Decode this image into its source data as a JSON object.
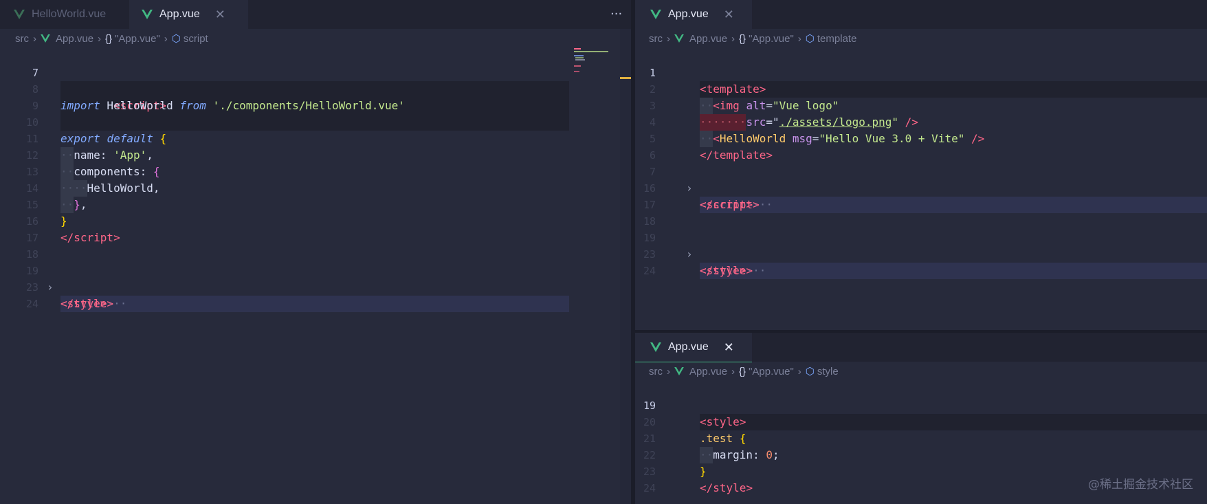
{
  "left": {
    "tabs": [
      {
        "label": "HelloWorld.vue",
        "active": false
      },
      {
        "label": "App.vue",
        "active": true,
        "close": "✕"
      }
    ],
    "more": "···",
    "breadcrumb": {
      "folder": "src",
      "file": "App.vue",
      "symbol_icon": "{}",
      "symbol": "\"App.vue\"",
      "section": "script"
    },
    "lines": [
      {
        "n": "7"
      },
      {
        "n": "8"
      },
      {
        "n": "9"
      },
      {
        "n": "10"
      },
      {
        "n": "11"
      },
      {
        "n": "12"
      },
      {
        "n": "13"
      },
      {
        "n": "14"
      },
      {
        "n": "15"
      },
      {
        "n": "16"
      },
      {
        "n": "17"
      },
      {
        "n": "18"
      },
      {
        "n": "19"
      },
      {
        "n": "23"
      },
      {
        "n": "24"
      }
    ],
    "code": {
      "import_kw": "import",
      "import_name": " HelloWorld ",
      "from_kw": "from",
      "import_path": "'./components/HelloWorld.vue'",
      "export_kw": "export",
      "default_kw": "default",
      "name_key": "name:",
      "name_val": "'App'",
      "components_key": "components:",
      "helloworld": "HelloWorld,",
      "script": "script",
      "style": "style"
    }
  },
  "right_top": {
    "tab": {
      "label": "App.vue",
      "close": "✕"
    },
    "breadcrumb": {
      "folder": "src",
      "file": "App.vue",
      "symbol_icon": "{}",
      "symbol": "\"App.vue\"",
      "section": "template"
    },
    "lines": [
      {
        "n": "1"
      },
      {
        "n": "2"
      },
      {
        "n": "3"
      },
      {
        "n": "4"
      },
      {
        "n": "5"
      },
      {
        "n": "6"
      },
      {
        "n": "7"
      },
      {
        "n": "16"
      },
      {
        "n": "17"
      },
      {
        "n": "18"
      },
      {
        "n": "19"
      },
      {
        "n": "23"
      },
      {
        "n": "24"
      }
    ],
    "code": {
      "template": "template",
      "img": "img",
      "alt_attr": "alt",
      "alt_val": "\"Vue logo\"",
      "src_attr": "src",
      "src_val": "./assets/logo.png",
      "hw": "HelloWorld",
      "msg_attr": "msg",
      "msg_val": "\"Hello Vue 3.0 + Vite\"",
      "script": "script",
      "style": "style"
    }
  },
  "right_bottom": {
    "tab": {
      "label": "App.vue",
      "close": "✕"
    },
    "breadcrumb": {
      "folder": "src",
      "file": "App.vue",
      "symbol_icon": "{}",
      "symbol": "\"App.vue\"",
      "section": "style"
    },
    "lines": [
      {
        "n": "19"
      },
      {
        "n": "20"
      },
      {
        "n": "21"
      },
      {
        "n": "22"
      },
      {
        "n": "23"
      },
      {
        "n": "24"
      }
    ],
    "code": {
      "style": "style",
      "selector": ".test",
      "prop": "margin:",
      "val": "0"
    }
  },
  "watermark": "@稀土掘金技术社区",
  "colors": {
    "background": "#272a3b",
    "tabbar": "#212331",
    "vue_green": "#42b883",
    "tag": "#ff6688"
  }
}
